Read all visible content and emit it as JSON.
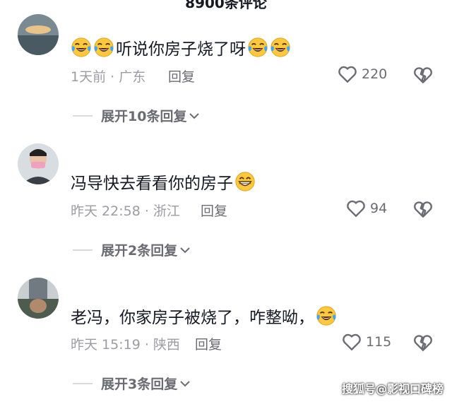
{
  "header": {
    "comment_count": "8900条评论"
  },
  "comments": [
    {
      "text": "听说你房子烧了呀",
      "meta": "1天前 · 广东",
      "reply_label": "回复",
      "likes": "220",
      "expand_label": "展开10条回复"
    },
    {
      "text": "冯导快去看看你的房子",
      "meta": "昨天 22:58 · 浙江",
      "reply_label": "回复",
      "likes": "94",
      "expand_label": "展开2条回复"
    },
    {
      "text": "老冯，你家房子被烧了，咋整呦，",
      "meta": "昨天 15:19 · 陕西",
      "reply_label": "回复",
      "likes": "115",
      "expand_label": "展开3条回复"
    }
  ],
  "watermark": "搜狐号@影视口碑榜",
  "icons": {
    "emoji_laugh_cry": "laughing-crying-face",
    "emoji_grin": "grinning-face",
    "like": "heart-outline",
    "dislike": "broken-heart",
    "expand": "chevron-down"
  },
  "colors": {
    "emoji_yellow": "#FFC83D",
    "tear_blue": "#3FA7F2"
  }
}
